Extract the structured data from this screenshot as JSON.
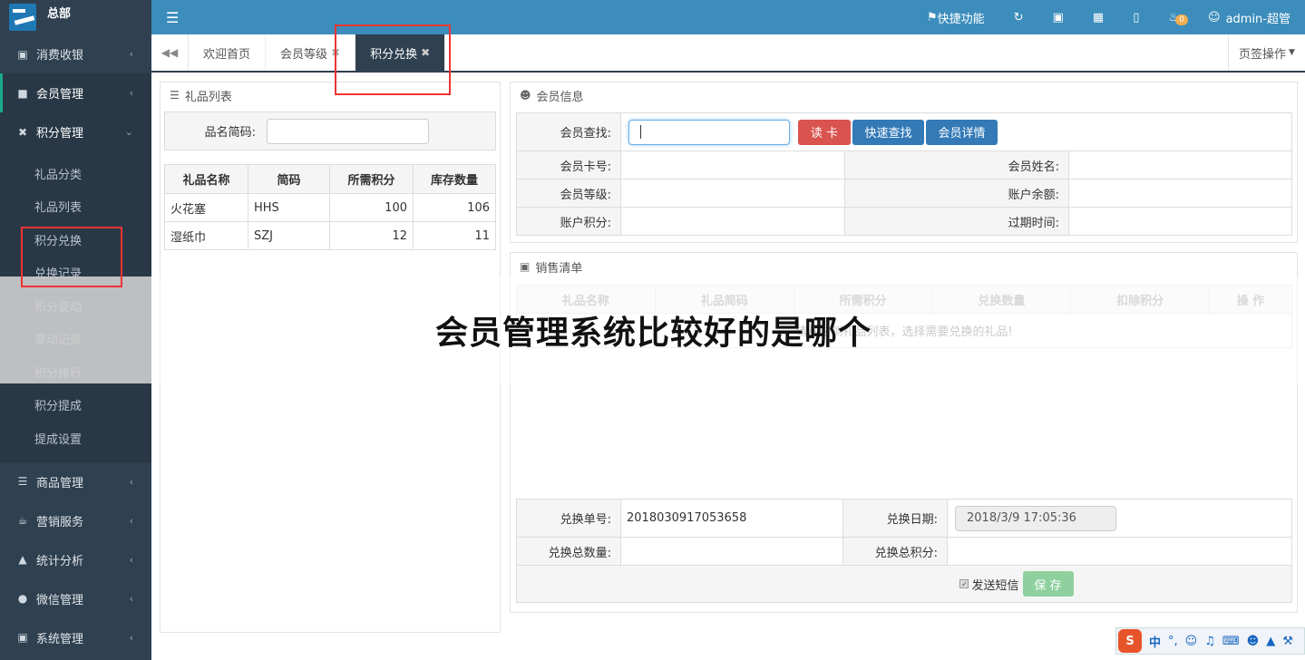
{
  "app": {
    "title": "总部"
  },
  "sidebar": {
    "items": [
      {
        "label": "消费收银",
        "icon": "lock-icon"
      },
      {
        "label": "会员管理",
        "icon": "briefcase-icon"
      },
      {
        "label": "积分管理",
        "icon": "exchange-icon"
      }
    ],
    "submenu": [
      "礼品分类",
      "礼品列表",
      "积分兑换",
      "兑换记录",
      "积分变动",
      "变动记录",
      "积分排行",
      "积分提成",
      "提成设置"
    ],
    "items_after": [
      {
        "label": "商品管理",
        "icon": "list-icon"
      },
      {
        "label": "营销服务",
        "icon": "coffee-icon"
      },
      {
        "label": "统计分析",
        "icon": "chart-icon"
      },
      {
        "label": "微信管理",
        "icon": "wechat-icon"
      },
      {
        "label": "系统管理",
        "icon": "desktop-icon"
      }
    ]
  },
  "topbar": {
    "quick": "快捷功能",
    "badge": "0",
    "user": "admin-超管"
  },
  "tabs": {
    "items": [
      "欢迎首页",
      "会员等级",
      "积分兑换"
    ],
    "ops": "页签操作"
  },
  "gift_panel": {
    "title": "礼品列表",
    "search_label": "品名简码:",
    "columns": [
      "礼品名称",
      "简码",
      "所需积分",
      "库存数量"
    ],
    "rows": [
      [
        "火花塞",
        "HHS",
        "100",
        "106"
      ],
      [
        "湿纸巾",
        "SZJ",
        "12",
        "11"
      ]
    ]
  },
  "member_panel": {
    "title": "会员信息",
    "search_label": "会员查找:",
    "btn_read": "读 卡",
    "btn_quick": "快速查找",
    "btn_detail": "会员详情",
    "card_label": "会员卡号:",
    "name_label": "会员姓名:",
    "level_label": "会员等级:",
    "balance_label": "账户余额:",
    "points_label": "账户积分:",
    "expire_label": "过期时间:"
  },
  "sale_panel": {
    "title": "销售清单",
    "columns": [
      "礼品名称",
      "礼品简码",
      "所需积分",
      "兑换数量",
      "扣除积分",
      "操 作"
    ],
    "empty_hint": "请从左侧礼品列表，选择需要兑换的礼品!",
    "order_label": "兑换单号:",
    "order_value": "2018030917053658",
    "date_label": "兑换日期:",
    "date_value": "2018/3/9 17:05:36",
    "total_qty_label": "兑换总数量:",
    "total_pts_label": "兑换总积分:",
    "sms_label": "发送短信",
    "save_label": "保 存"
  },
  "overlay_title": "会员管理系统比较好的是哪个",
  "ime": {
    "logo": "S",
    "mode": "中"
  }
}
